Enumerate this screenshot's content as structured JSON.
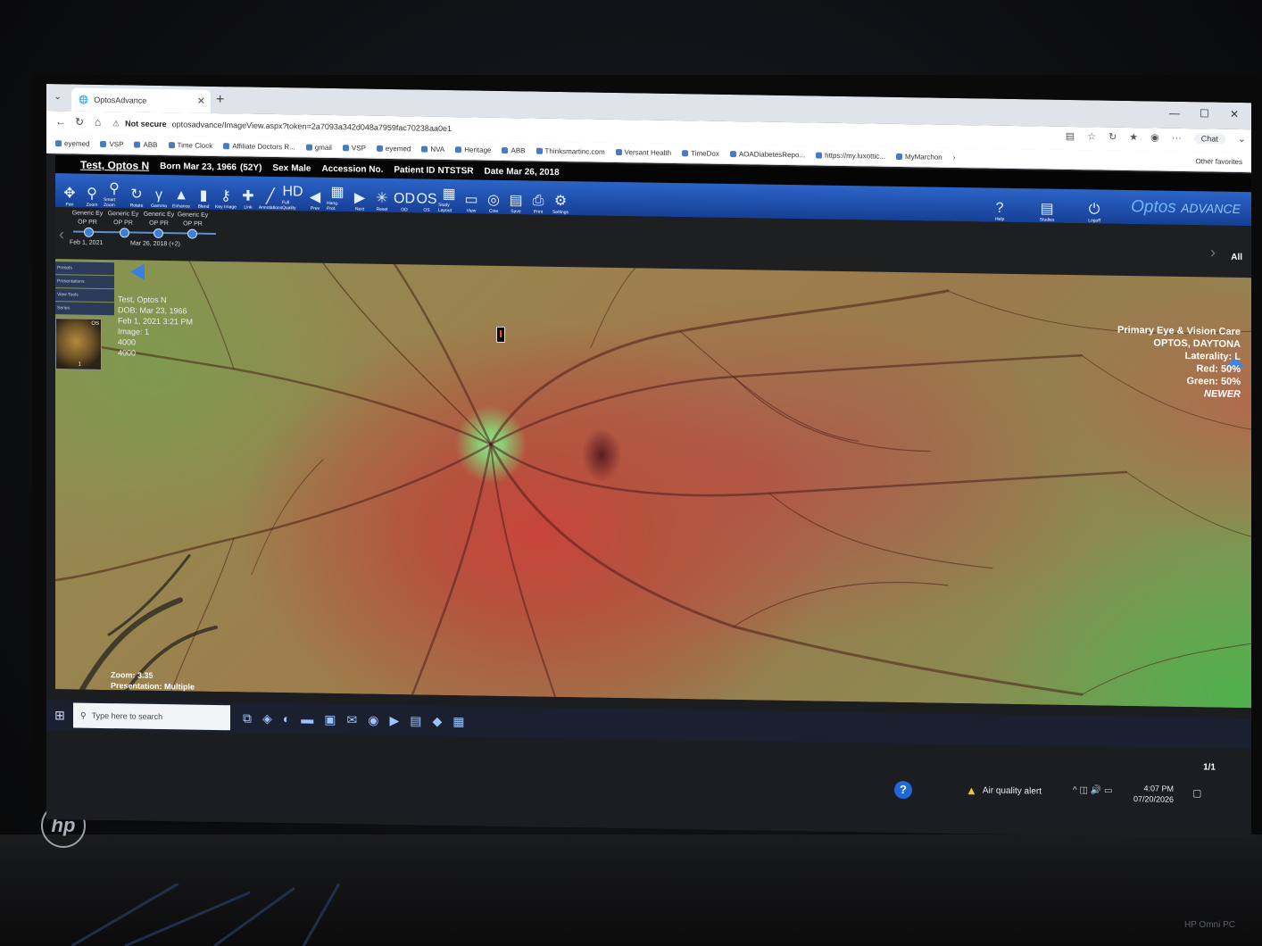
{
  "browser": {
    "tab_title": "OptosAdvance",
    "url_warning": "Not secure",
    "url": "optosadvance/ImageView.aspx?token=2a7093a342d048a7959fac70238aa0e1",
    "chat_label": "Chat",
    "bookmarks": [
      "eyemed",
      "VSP",
      "ABB",
      "Time Clock",
      "Affiliate Doctors R...",
      "gmail",
      "VSP",
      "eyemed",
      "NVA",
      "Heritage",
      "ABB",
      "Thinksmartinc.com",
      "Versant Health",
      "TimeDox",
      "AOADiabetesRepo...",
      "https://my.luxottic...",
      "MyMarchon"
    ],
    "other_favorites": "Other favorites"
  },
  "patient": {
    "name": "Test, Optos N",
    "born_label": "Born",
    "born": "Mar 23, 1966",
    "age": "(52Y)",
    "sex_label": "Sex",
    "sex": "Male",
    "accession_label": "Accession No.",
    "patient_id_label": "Patient ID",
    "patient_id": "NTSTSR",
    "date_label": "Date",
    "date": "Mar 26, 2018"
  },
  "toolbar": {
    "tools": [
      {
        "label": "Pan",
        "icon": "pan-icon",
        "glyph": "✥"
      },
      {
        "label": "Zoom",
        "icon": "zoom-icon",
        "glyph": "⚲"
      },
      {
        "label": "Smart Zoom",
        "icon": "smart-zoom-icon",
        "glyph": "⚲"
      },
      {
        "label": "Rotate",
        "icon": "rotate-icon",
        "glyph": "↻"
      },
      {
        "label": "Gamma",
        "icon": "gamma-icon",
        "glyph": "γ"
      },
      {
        "label": "Enhance",
        "icon": "enhance-icon",
        "glyph": "▲"
      },
      {
        "label": "Blend",
        "icon": "blend-icon",
        "glyph": "▮"
      },
      {
        "label": "Key Image",
        "icon": "key-image-icon",
        "glyph": "⚷"
      },
      {
        "label": "Link",
        "icon": "link-icon",
        "glyph": "✚"
      },
      {
        "label": "Annotations",
        "icon": "annotations-icon",
        "glyph": "╱"
      },
      {
        "label": "Full Quality",
        "icon": "full-quality-icon",
        "glyph": "HD"
      },
      {
        "label": "Prev",
        "icon": "prev-icon",
        "glyph": "◀"
      },
      {
        "label": "Hang. Prot.",
        "icon": "hanging-protocol-icon",
        "glyph": "▦"
      },
      {
        "label": "Next",
        "icon": "next-icon",
        "glyph": "▶"
      },
      {
        "label": "Reset",
        "icon": "reset-icon",
        "glyph": "✳"
      },
      {
        "label": "OD",
        "icon": "od-icon",
        "glyph": "OD"
      },
      {
        "label": "OS",
        "icon": "os-icon",
        "glyph": "OS"
      },
      {
        "label": "Study Layout",
        "icon": "study-layout-icon",
        "glyph": "▦"
      },
      {
        "label": "View",
        "icon": "view-icon",
        "glyph": "▭"
      },
      {
        "label": "Cine",
        "icon": "cine-icon",
        "glyph": "◎"
      },
      {
        "label": "Save",
        "icon": "save-icon",
        "glyph": "▤"
      },
      {
        "label": "Print",
        "icon": "print-icon",
        "glyph": "⎙"
      },
      {
        "label": "Settings",
        "icon": "settings-icon",
        "glyph": "⚙"
      }
    ],
    "right_tools": [
      {
        "label": "Help",
        "icon": "help-icon",
        "glyph": "?"
      },
      {
        "label": "Studies",
        "icon": "studies-icon",
        "glyph": "▤"
      },
      {
        "label": "Logoff",
        "icon": "logoff-icon",
        "glyph": "⏻"
      }
    ],
    "brand": "Optos",
    "brand_suffix": "ADVANCE"
  },
  "timeline": {
    "items": [
      {
        "top": "Generic Ey",
        "bottom": "OP PR"
      },
      {
        "top": "Generic Ey",
        "bottom": "OP PR"
      },
      {
        "top": "Generic Ey",
        "bottom": "OP PR"
      },
      {
        "top": "Generic Ey",
        "bottom": "OP PR"
      }
    ],
    "date1": "Feb 1, 2021",
    "date2": "Mar 26, 2018 (+2)",
    "all_label": "All"
  },
  "side_panel": {
    "tabs": [
      "Presets",
      "Presentations",
      "View Tools",
      "Series"
    ],
    "thumb_label": "OS",
    "thumb_count": "1"
  },
  "image_info": {
    "lines": [
      "Test, Optos N",
      "DOB: Mar 23, 1966",
      "Feb 1, 2021 3:21 PM",
      "Image: 1",
      "4000",
      "4000"
    ],
    "practice": "Primary Eye & Vision Care",
    "device": "OPTOS, DAYTONA",
    "laterality": "Laterality: L",
    "red": "Red: 50%",
    "green": "Green: 50%",
    "newer": "NEWER",
    "zoom": "Zoom: 3.35",
    "presentation": "Presentation: Multiple",
    "page_count": "1/1"
  },
  "taskbar": {
    "search_placeholder": "Type here to search",
    "air_quality": "Air quality alert",
    "time": "4:07 PM",
    "date": "07/20/2026"
  }
}
